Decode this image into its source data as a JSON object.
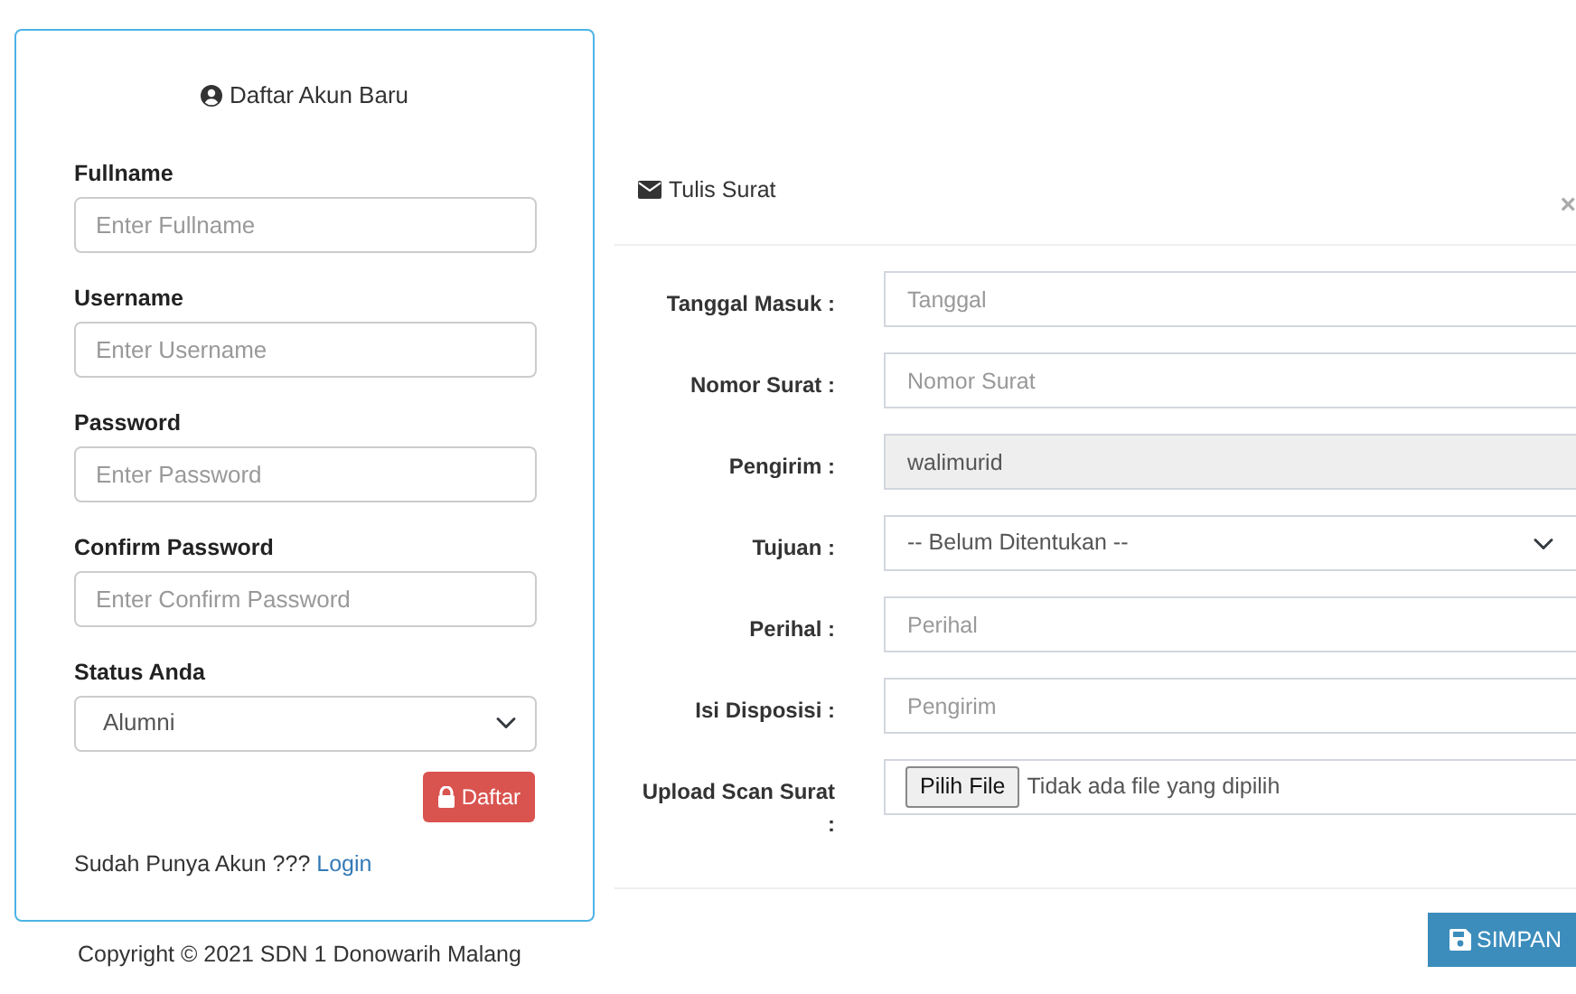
{
  "registration": {
    "title": "Daftar Akun Baru",
    "fields": [
      {
        "kind": "input",
        "label": "Fullname",
        "placeholder": "Enter Fullname"
      },
      {
        "kind": "input",
        "label": "Username",
        "placeholder": "Enter Username"
      },
      {
        "kind": "input",
        "label": "Password",
        "placeholder": "Enter Password"
      },
      {
        "kind": "input",
        "label": "Confirm Password",
        "placeholder": "Enter Confirm Password"
      },
      {
        "kind": "select",
        "label": "Status Anda",
        "value": "Alumni"
      }
    ],
    "submit": "Daftar",
    "login_prompt": "Sudah Punya Akun ???",
    "login_link": "Login"
  },
  "footer": "Copyright © 2021 SDN 1 Donowarih Malang",
  "letter_form": {
    "title": "Tulis Surat",
    "close": "×",
    "fields": [
      {
        "kind": "input",
        "label": "Tanggal Masuk :",
        "placeholder": "Tanggal"
      },
      {
        "kind": "input",
        "label": "Nomor Surat :",
        "placeholder": "Nomor Surat"
      },
      {
        "kind": "readonly",
        "label": "Pengirim :",
        "value": "walimurid"
      },
      {
        "kind": "select",
        "label": "Tujuan :",
        "value": "-- Belum Ditentukan --"
      },
      {
        "kind": "input",
        "label": "Perihal :",
        "placeholder": "Perihal"
      },
      {
        "kind": "input",
        "label": "Isi Disposisi :",
        "placeholder": "Pengirim"
      },
      {
        "kind": "file",
        "label": "Upload Scan Surat :",
        "button": "Pilih File",
        "status": "Tidak ada file yang dipilih"
      }
    ],
    "submit": "SIMPAN"
  }
}
